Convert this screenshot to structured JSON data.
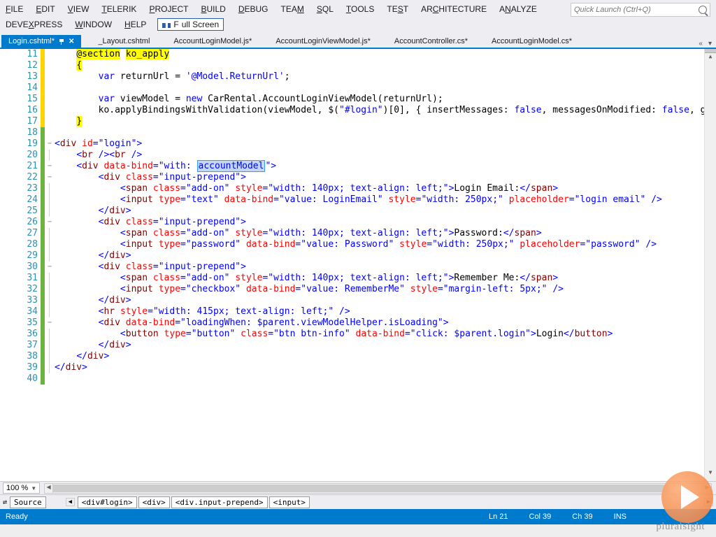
{
  "menubar": {
    "rows": [
      [
        {
          "mnemonic": "F",
          "rest": "ILE"
        },
        {
          "mnemonic": "E",
          "rest": "DIT"
        },
        {
          "mnemonic": "V",
          "rest": "IEW"
        },
        {
          "mnemonic": "T",
          "rest": "ELERIK"
        },
        {
          "mnemonic": "P",
          "rest": "ROJECT"
        },
        {
          "mnemonic": "B",
          "rest": "UILD"
        },
        {
          "mnemonic": "D",
          "rest": "EBUG"
        },
        {
          "mnemonic": "",
          "rest": "TEAM",
          "m2": "M",
          "pre": "TEA"
        },
        {
          "mnemonic": "S",
          "rest": "QL"
        },
        {
          "mnemonic": "T",
          "rest": "OOLS"
        },
        {
          "mnemonic": "",
          "rest": "TEST",
          "m2": "S",
          "pre": "TE",
          "post": "T"
        },
        {
          "mnemonic": "",
          "rest": "ARCHITECTURE",
          "m2": "C",
          "pre": "AR",
          "post": "HITECTURE"
        },
        {
          "mnemonic": "",
          "rest": "ANALYZE",
          "m2": "N",
          "pre": "A",
          "post": "ALYZE"
        }
      ],
      [
        {
          "mnemonic": "",
          "rest": "DEVEXPRESS",
          "m2": "X",
          "pre": "DEVE",
          "post": "PRESS"
        },
        {
          "mnemonic": "W",
          "rest": "INDOW"
        },
        {
          "mnemonic": "H",
          "rest": "ELP"
        }
      ]
    ],
    "fullscreen": "Full Screen",
    "quick_launch_placeholder": "Quick Launch (Ctrl+Q)"
  },
  "tabs": [
    {
      "label": "Login.cshtml*",
      "active": true
    },
    {
      "label": "_Layout.cshtml"
    },
    {
      "label": "AccountLoginModel.js*"
    },
    {
      "label": "AccountLoginViewModel.js*"
    },
    {
      "label": "AccountController.cs*"
    },
    {
      "label": "AccountLoginModel.cs*"
    }
  ],
  "editor": {
    "first_line": 11,
    "lines": [
      {
        "n": 11,
        "mod": "yellow",
        "fold": "",
        "html": "    <span class='yel'>@section</span> <span class='yel'>ko_apply</span>"
      },
      {
        "n": 12,
        "mod": "yellow",
        "fold": "",
        "html": "    <span class='yel'>{</span>"
      },
      {
        "n": 13,
        "mod": "yellow",
        "fold": "",
        "html": "        <span class='kw'>var</span> returnUrl = <span class='str'>'@Model.ReturnUrl'</span>;"
      },
      {
        "n": 14,
        "mod": "yellow",
        "fold": "",
        "html": ""
      },
      {
        "n": 15,
        "mod": "yellow",
        "fold": "",
        "html": "        <span class='kw'>var</span> viewModel = <span class='kw'>new</span> CarRental.AccountLoginViewModel(returnUrl);"
      },
      {
        "n": 16,
        "mod": "yellow",
        "fold": "",
        "html": "        ko.applyBindingsWithValidation(viewModel, $(<span class='str'>\"#login\"</span>)[0], { insertMessages: <span class='kw'>false</span>, messagesOnModified: <span class='kw'>false</span>, grouping: { deep:"
      },
      {
        "n": 17,
        "mod": "yellow",
        "fold": "",
        "html": "    <span class='yel'>}</span>"
      },
      {
        "n": 18,
        "mod": "green",
        "fold": "",
        "html": ""
      },
      {
        "n": 19,
        "mod": "green",
        "fold": "box",
        "html": "<span class='pun'>&lt;</span><span class='tag'>div</span> <span class='attr'>id</span><span class='pun'>=</span><span class='str'>\"login\"</span><span class='pun'>&gt;</span>"
      },
      {
        "n": 20,
        "mod": "green",
        "fold": "line",
        "html": "    <span class='pun'>&lt;</span><span class='tag'>br</span> <span class='pun'>/&gt;&lt;</span><span class='tag'>br</span> <span class='pun'>/&gt;</span>"
      },
      {
        "n": 21,
        "mod": "green",
        "fold": "box",
        "html": "    <span class='pun'>&lt;</span><span class='tag'>div</span> <span class='attr'>data-bind</span><span class='pun'>=</span><span class='str'>\"with: <span class='hl'>accountModel</span>\"</span><span class='pun'>&gt;</span>"
      },
      {
        "n": 22,
        "mod": "green",
        "fold": "box",
        "html": "        <span class='pun'>&lt;</span><span class='tag'>div</span> <span class='attr'>class</span><span class='pun'>=</span><span class='str'>\"input-prepend\"</span><span class='pun'>&gt;</span>"
      },
      {
        "n": 23,
        "mod": "green",
        "fold": "line",
        "html": "            <span class='pun'>&lt;</span><span class='tag'>span</span> <span class='attr'>class</span><span class='pun'>=</span><span class='str'>\"add-on\"</span> <span class='attr'>style</span><span class='pun'>=</span><span class='str'>\"width: 140px; text-align: left;\"</span><span class='pun'>&gt;</span>Login Email:<span class='pun'>&lt;/</span><span class='tag'>span</span><span class='pun'>&gt;</span>"
      },
      {
        "n": 24,
        "mod": "green",
        "fold": "line",
        "html": "            <span class='pun'>&lt;</span><span class='tag'>input</span> <span class='attr'>type</span><span class='pun'>=</span><span class='str'>\"text\"</span> <span class='attr'>data-bind</span><span class='pun'>=</span><span class='str'>\"value: LoginEmail\"</span> <span class='attr'>style</span><span class='pun'>=</span><span class='str'>\"width: 250px;\"</span> <span class='attr'>placeholder</span><span class='pun'>=</span><span class='str'>\"login email\"</span> <span class='pun'>/&gt;</span>"
      },
      {
        "n": 25,
        "mod": "green",
        "fold": "line",
        "html": "        <span class='pun'>&lt;/</span><span class='tag'>div</span><span class='pun'>&gt;</span>"
      },
      {
        "n": 26,
        "mod": "green",
        "fold": "box",
        "html": "        <span class='pun'>&lt;</span><span class='tag'>div</span> <span class='attr'>class</span><span class='pun'>=</span><span class='str'>\"input-prepend\"</span><span class='pun'>&gt;</span>"
      },
      {
        "n": 27,
        "mod": "green",
        "fold": "line",
        "html": "            <span class='pun'>&lt;</span><span class='tag'>span</span> <span class='attr'>class</span><span class='pun'>=</span><span class='str'>\"add-on\"</span> <span class='attr'>style</span><span class='pun'>=</span><span class='str'>\"width: 140px; text-align: left;\"</span><span class='pun'>&gt;</span>Password:<span class='pun'>&lt;/</span><span class='tag'>span</span><span class='pun'>&gt;</span>"
      },
      {
        "n": 28,
        "mod": "green",
        "fold": "line",
        "html": "            <span class='pun'>&lt;</span><span class='tag'>input</span> <span class='attr'>type</span><span class='pun'>=</span><span class='str'>\"password\"</span> <span class='attr'>data-bind</span><span class='pun'>=</span><span class='str'>\"value: Password\"</span> <span class='attr'>style</span><span class='pun'>=</span><span class='str'>\"width: 250px;\"</span> <span class='attr'>placeholder</span><span class='pun'>=</span><span class='str'>\"password\"</span> <span class='pun'>/&gt;</span>"
      },
      {
        "n": 29,
        "mod": "green",
        "fold": "line",
        "html": "        <span class='pun'>&lt;/</span><span class='tag'>div</span><span class='pun'>&gt;</span>"
      },
      {
        "n": 30,
        "mod": "green",
        "fold": "box",
        "html": "        <span class='pun'>&lt;</span><span class='tag'>div</span> <span class='attr'>class</span><span class='pun'>=</span><span class='str'>\"input-prepend\"</span><span class='pun'>&gt;</span>"
      },
      {
        "n": 31,
        "mod": "green",
        "fold": "line",
        "html": "            <span class='pun'>&lt;</span><span class='tag'>span</span> <span class='attr'>class</span><span class='pun'>=</span><span class='str'>\"add-on\"</span> <span class='attr'>style</span><span class='pun'>=</span><span class='str'>\"width: 140px; text-align: left;\"</span><span class='pun'>&gt;</span>Remember Me:<span class='pun'>&lt;/</span><span class='tag'>span</span><span class='pun'>&gt;</span>"
      },
      {
        "n": 32,
        "mod": "green",
        "fold": "line",
        "html": "            <span class='pun'>&lt;</span><span class='tag'>input</span> <span class='attr'>type</span><span class='pun'>=</span><span class='str'>\"checkbox\"</span> <span class='attr'>data-bind</span><span class='pun'>=</span><span class='str'>\"value: RememberMe\"</span> <span class='attr'>style</span><span class='pun'>=</span><span class='str'>\"margin-left: 5px;\"</span> <span class='pun'>/&gt;</span>"
      },
      {
        "n": 33,
        "mod": "green",
        "fold": "line",
        "html": "        <span class='pun'>&lt;/</span><span class='tag'>div</span><span class='pun'>&gt;</span>"
      },
      {
        "n": 34,
        "mod": "green",
        "fold": "line",
        "html": "        <span class='pun'>&lt;</span><span class='tag'>hr</span> <span class='attr'>style</span><span class='pun'>=</span><span class='str'>\"width: 415px; text-align: left;\"</span> <span class='pun'>/&gt;</span>"
      },
      {
        "n": 35,
        "mod": "green",
        "fold": "box",
        "html": "        <span class='pun'>&lt;</span><span class='tag'>div</span> <span class='attr'>data-bind</span><span class='pun'>=</span><span class='str'>\"loadingWhen: $parent.viewModelHelper.isLoading\"</span><span class='pun'>&gt;</span>"
      },
      {
        "n": 36,
        "mod": "green",
        "fold": "line",
        "html": "            <span class='pun'>&lt;</span><span class='tag'>button</span> <span class='attr'>type</span><span class='pun'>=</span><span class='str'>\"button\"</span> <span class='attr'>class</span><span class='pun'>=</span><span class='str'>\"btn btn-info\"</span> <span class='attr'>data-bind</span><span class='pun'>=</span><span class='str'>\"click: $parent.login\"</span><span class='pun'>&gt;</span>Login<span class='pun'>&lt;/</span><span class='tag'>button</span><span class='pun'>&gt;</span>"
      },
      {
        "n": 37,
        "mod": "green",
        "fold": "line",
        "html": "        <span class='pun'>&lt;/</span><span class='tag'>div</span><span class='pun'>&gt;</span>"
      },
      {
        "n": 38,
        "mod": "green",
        "fold": "line",
        "html": "    <span class='pun'>&lt;/</span><span class='tag'>div</span><span class='pun'>&gt;</span>"
      },
      {
        "n": 39,
        "mod": "green",
        "fold": "line",
        "html": "<span class='pun'>&lt;/</span><span class='tag'>div</span><span class='pun'>&gt;</span>"
      },
      {
        "n": 40,
        "mod": "green",
        "fold": "",
        "html": ""
      }
    ]
  },
  "zoom": "100 %",
  "breadcrumb": {
    "source": "Source",
    "items": [
      "<div#login>",
      "<div>",
      "<div.input-prepend>",
      "<input>"
    ]
  },
  "statusbar": {
    "ready": "Ready",
    "ln": "Ln 21",
    "col": "Col 39",
    "ch": "Ch 39",
    "ins": "INS"
  },
  "watermark": "pluralsight"
}
